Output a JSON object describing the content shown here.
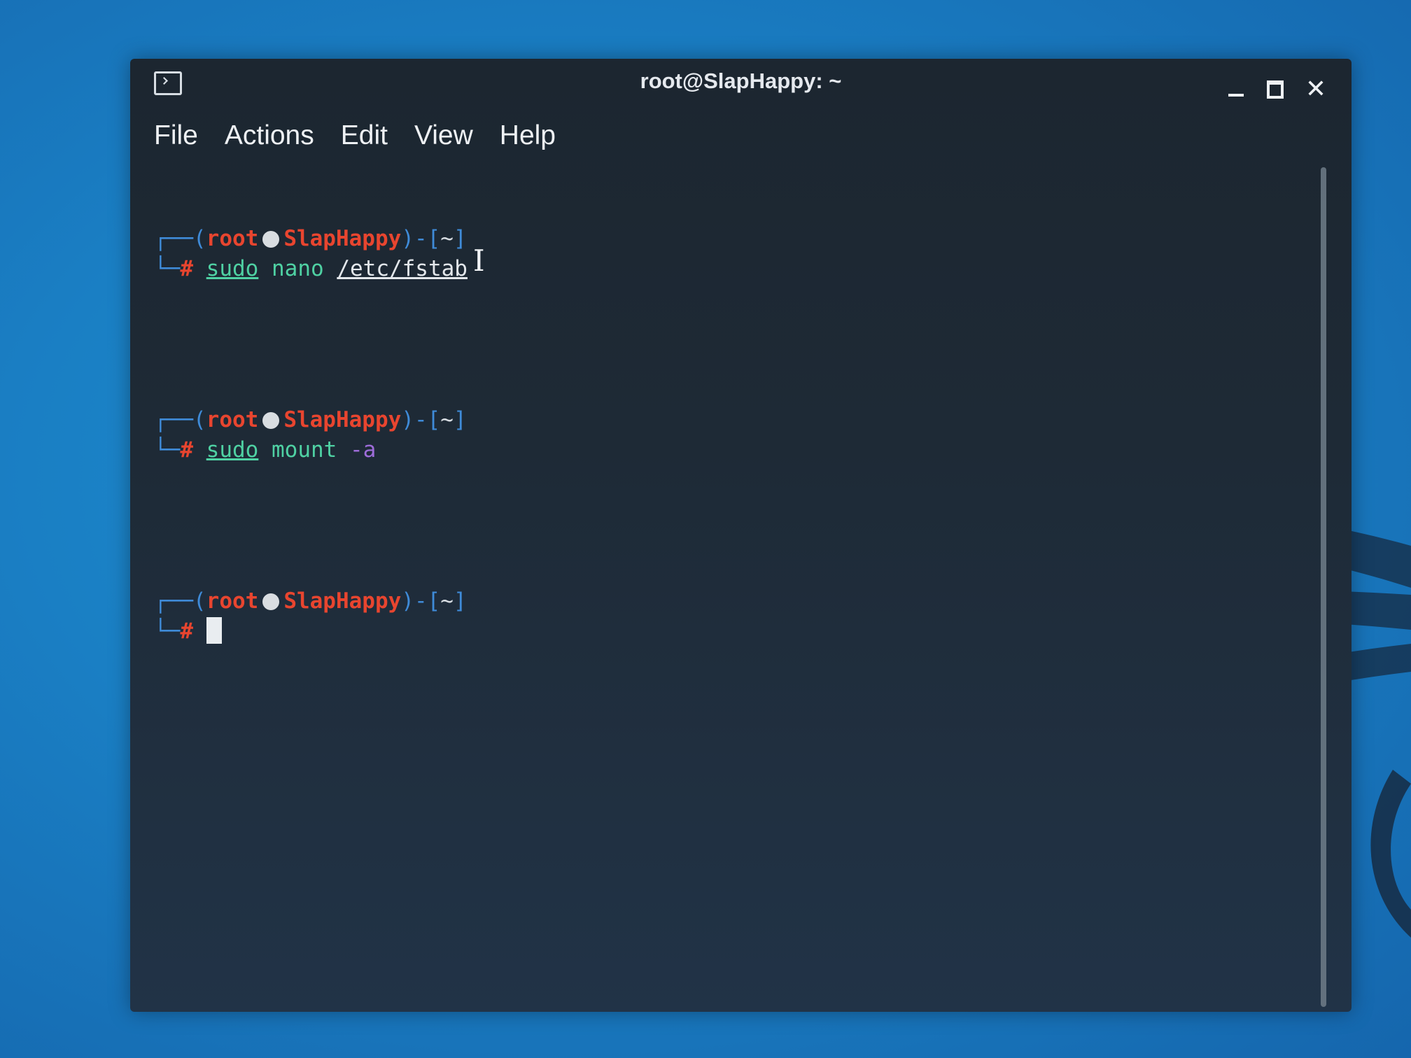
{
  "window": {
    "title": "root@SlapHappy: ~"
  },
  "menu": [
    "File",
    "Actions",
    "Edit",
    "View",
    "Help"
  ],
  "terminal": {
    "user": "root",
    "host": "SlapHappy",
    "dir": "~",
    "hash": "#",
    "commands": [
      {
        "prog": "sudo",
        "arg1": "nano",
        "arg2": "/etc/fstab"
      },
      {
        "prog": "sudo",
        "arg1": "mount",
        "arg2": "-a"
      }
    ]
  },
  "icons": {
    "app": "terminal-icon",
    "minimize": "minimize-icon",
    "maximize": "maximize-icon",
    "close": "close-icon",
    "skull": "skull-icon",
    "pointer": "text-cursor-icon"
  },
  "colors": {
    "prompt_red": "#e8452f",
    "prompt_blue": "#3f8bd8",
    "cmd_green": "#4fd1a3",
    "flag_purple": "#9d6cd8"
  }
}
